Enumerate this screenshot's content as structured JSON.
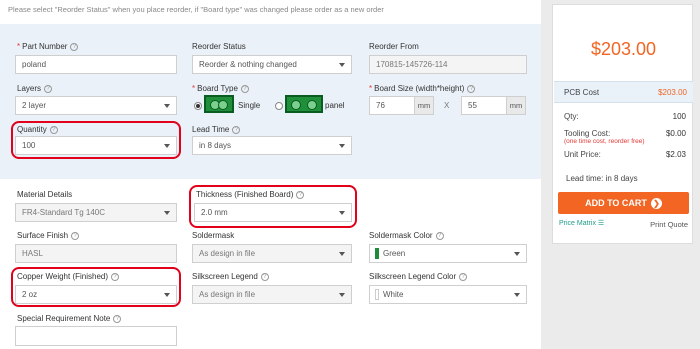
{
  "notice": "Please select \"Reorder Status\" when you place reorder, if \"Board type\" was changed please order as a new order",
  "form": {
    "part_number": {
      "label": "Part Number",
      "value": "poland"
    },
    "reorder_status": {
      "label": "Reorder Status",
      "value": "Reorder & nothing changed"
    },
    "reorder_from": {
      "label": "Reorder From",
      "value": "170815-145726-114"
    },
    "layers": {
      "label": "Layers",
      "value": "2 layer"
    },
    "board_type": {
      "label": "Board Type",
      "single": "Single",
      "panel": "panel",
      "selected": "Single"
    },
    "board_size": {
      "label": "Board Size (width*height)",
      "width": "76",
      "height": "55",
      "unit": "mm",
      "sep": "X"
    },
    "quantity": {
      "label": "Quantity",
      "value": "100"
    },
    "lead_time": {
      "label": "Lead Time",
      "value": "in 8 days"
    },
    "material": {
      "label": "Material Details",
      "value": "FR4-Standard Tg 140C"
    },
    "thickness": {
      "label": "Thickness (Finished Board)",
      "value": "2.0 mm"
    },
    "surface_finish": {
      "label": "Surface Finish",
      "value": "HASL"
    },
    "soldermask": {
      "label": "Soldermask",
      "value": "As design in file"
    },
    "soldermask_color": {
      "label": "Soldermask Color",
      "value": "Green",
      "color": "#1e8c3a"
    },
    "copper_weight": {
      "label": "Copper Weight (Finished)",
      "value": "2 oz"
    },
    "silkscreen_legend": {
      "label": "Silkscreen Legend",
      "value": "As design in file"
    },
    "silkscreen_color": {
      "label": "Silkscreen Legend Color",
      "value": "White",
      "color": "#ffffff"
    },
    "special_note": {
      "label": "Special Requirement Note",
      "value": ""
    }
  },
  "summary": {
    "total": "$203.00",
    "pcb_cost_label": "PCB Cost",
    "pcb_cost": "$203.00",
    "qty_label": "Qty:",
    "qty": "100",
    "tooling_label": "Tooling Cost:",
    "tooling_note": "(one time cost, reorder free)",
    "tooling": "$0.00",
    "unit_label": "Unit Price:",
    "unit": "$2.03",
    "lead_time": "Lead time: in 8 days",
    "add_to_cart": "ADD TO CART",
    "price_matrix": "Price Matrix",
    "print_quote": "Print Quote"
  },
  "colors": {
    "accent": "#f26522",
    "highlight": "#e2001a",
    "band": "#eaf1f8"
  }
}
